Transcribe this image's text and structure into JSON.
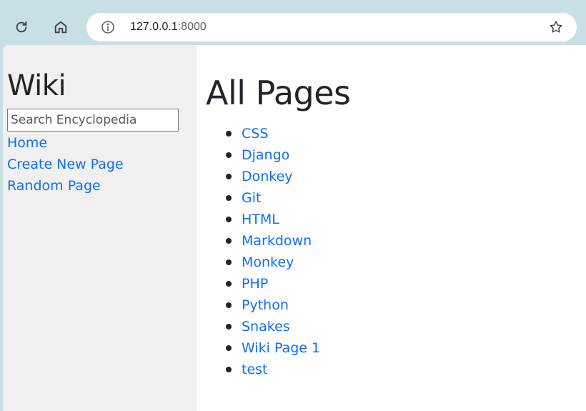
{
  "browser": {
    "url_host": "127.0.0.1",
    "url_port": ":8000"
  },
  "sidebar": {
    "brand": "Wiki",
    "search_placeholder": "Search Encyclopedia",
    "links": [
      "Home",
      "Create New Page",
      "Random Page"
    ]
  },
  "main": {
    "title": "All Pages",
    "entries": [
      "CSS",
      "Django",
      "Donkey",
      "Git",
      "HTML",
      "Markdown",
      "Monkey",
      "PHP",
      "Python",
      "Snakes",
      "Wiki Page 1",
      "test"
    ]
  },
  "colors": {
    "link": "#0d6efd",
    "sidebar_bg": "#f0f0f0",
    "chrome_bg": "#c8e0e4"
  }
}
